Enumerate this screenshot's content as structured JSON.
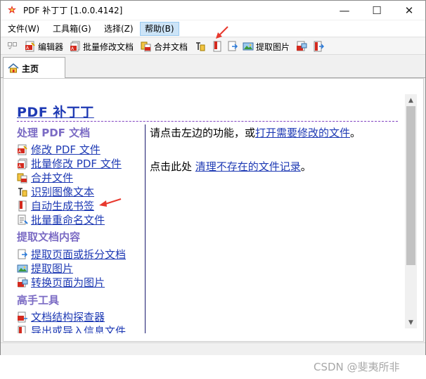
{
  "window": {
    "title": "PDF 补丁丁 [1.0.0.4142]",
    "controls": {
      "minimize": "—",
      "maximize": "☐",
      "close": "✕"
    }
  },
  "menu": [
    {
      "label": "文件(W)"
    },
    {
      "label": "工具箱(G)"
    },
    {
      "label": "选择(Z)"
    },
    {
      "label": "帮助(B)",
      "active": true
    }
  ],
  "toolbar": {
    "editor": "编辑器",
    "batch_modify": "批量修改文档",
    "merge": "合并文档",
    "extract_images": "提取图片"
  },
  "tabs": [
    {
      "label": "主页",
      "icon": "home-icon"
    }
  ],
  "home": {
    "title": "PDF 补丁丁",
    "sections": [
      {
        "heading": "处理 PDF 文档",
        "links": [
          {
            "label": "修改 PDF 文件",
            "icon": "pdf-edit-icon"
          },
          {
            "label": "批量修改 PDF 文件",
            "icon": "pdf-batch-icon"
          },
          {
            "label": "合并文件",
            "icon": "merge-icon"
          },
          {
            "label": "识别图像文本",
            "icon": "ocr-icon"
          },
          {
            "label": "自动生成书签",
            "icon": "bookmark-icon"
          },
          {
            "label": "批量重命名文件",
            "icon": "rename-icon"
          }
        ]
      },
      {
        "heading": "提取文档内容",
        "links": [
          {
            "label": "提取页面或拆分文档",
            "icon": "extract-pages-icon"
          },
          {
            "label": "提取图片",
            "icon": "extract-images-icon"
          },
          {
            "label": "转换页面为图片",
            "icon": "render-pages-icon"
          }
        ]
      },
      {
        "heading": "高手工具",
        "links": [
          {
            "label": "文档结构探查器",
            "icon": "structure-icon"
          },
          {
            "label": "导出或导入信息文件",
            "icon": "info-file-icon"
          }
        ]
      }
    ],
    "intro": {
      "prefix": "请点击左边的功能，或",
      "link": "打开需要修改的文件",
      "suffix": "。"
    },
    "cleanup": {
      "prefix": "点击此处 ",
      "link": "清理不存在的文件记录",
      "suffix": "。"
    }
  },
  "watermark": "CSDN @斐夷所非",
  "colors": {
    "link": "#1e3ab4",
    "section_heading": "#7b6bc4",
    "menu_active_bg": "#cce4f7",
    "annotation_arrow": "#e8392e"
  }
}
